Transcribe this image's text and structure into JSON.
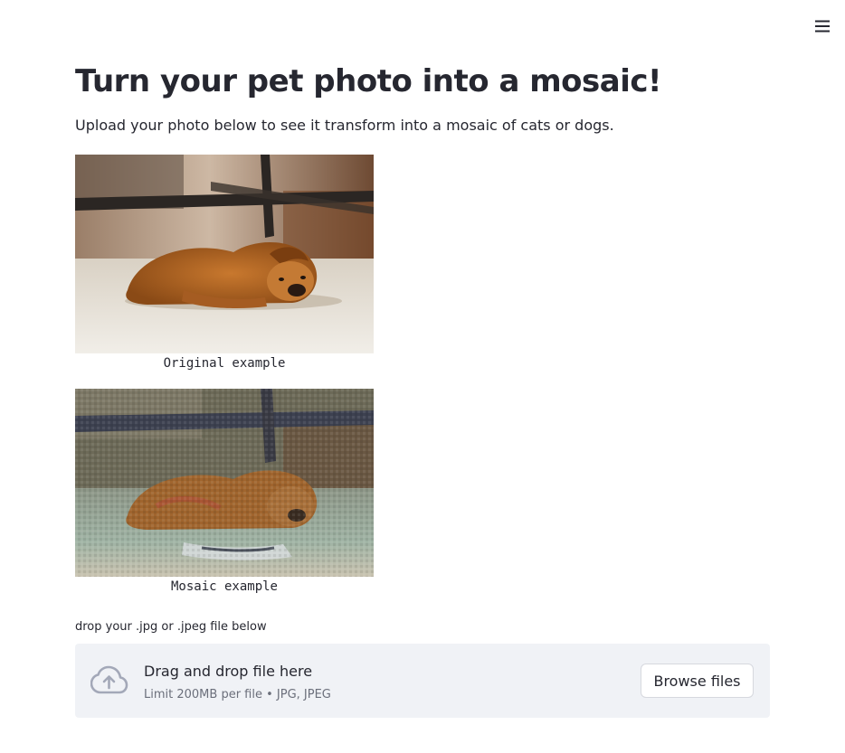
{
  "header": {
    "menu_icon": "hamburger-menu-icon"
  },
  "main": {
    "title": "Turn your pet photo into a mosaic!",
    "subtitle": "Upload your photo below to see it transform into a mosaic of cats or dogs."
  },
  "examples": [
    {
      "caption": "Original example",
      "image": "golden-retriever-puppy-photo"
    },
    {
      "caption": "Mosaic example",
      "image": "golden-retriever-puppy-mosaic"
    }
  ],
  "uploader": {
    "label": "drop your .jpg or .jpeg file below",
    "drop_title": "Drag and drop file here",
    "drop_hint": "Limit 200MB per file • JPG, JPEG",
    "browse_label": "Browse files",
    "icon": "cloud-upload-icon"
  },
  "colors": {
    "text": "#262730",
    "muted": "#6b6f7b",
    "dropzone_bg": "#f0f2f6",
    "button_border": "#d6d8de"
  }
}
